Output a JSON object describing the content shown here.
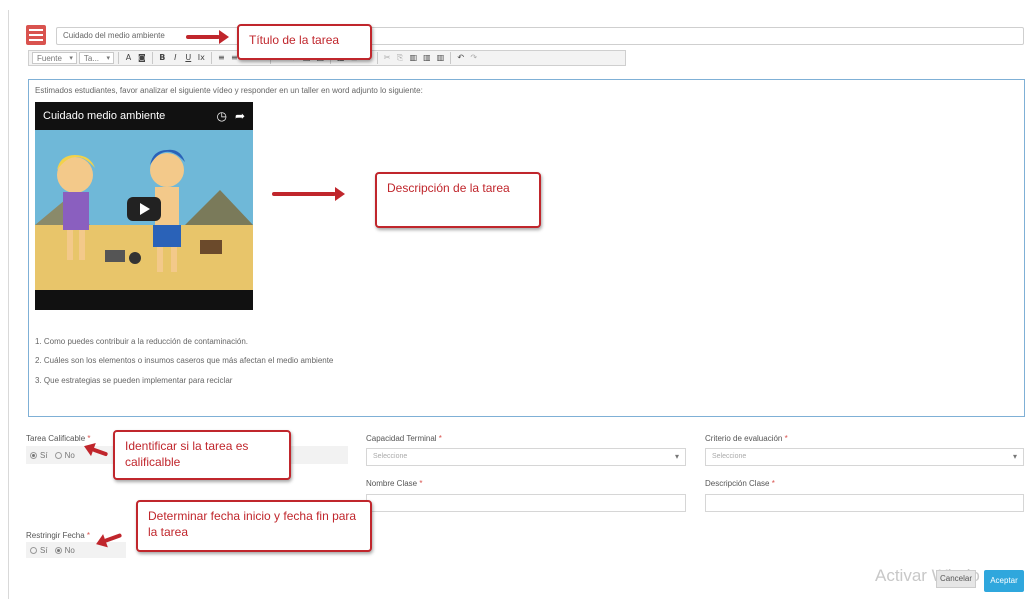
{
  "task": {
    "title_value": "Cuidado del medio ambiente"
  },
  "toolbar": {
    "items": [
      {
        "name": "font-dropdown",
        "label": "Fuente"
      },
      {
        "name": "size-dropdown",
        "label": "Ta..."
      },
      {
        "name": "text-color-button",
        "label": "A"
      },
      {
        "name": "bg-color-button",
        "label": "◙"
      },
      {
        "name": "bold-button",
        "label": "B"
      },
      {
        "name": "italic-button",
        "label": "I"
      },
      {
        "name": "underline-button",
        "label": "U"
      },
      {
        "name": "clear-format-button",
        "label": "Ix"
      },
      {
        "name": "align-left-button",
        "label": "≡"
      },
      {
        "name": "align-center-button",
        "label": "≡"
      },
      {
        "name": "align-right-button",
        "label": "≡"
      },
      {
        "name": "justify-button",
        "label": "≡"
      },
      {
        "name": "link-button",
        "label": "∞"
      },
      {
        "name": "unlink-button",
        "label": "⊘"
      },
      {
        "name": "image-button",
        "label": "▣"
      },
      {
        "name": "media-button",
        "label": "▤"
      },
      {
        "name": "table-button",
        "label": "▦"
      },
      {
        "name": "hr-button",
        "label": "⊟"
      },
      {
        "name": "special-char-button",
        "label": "Ω"
      },
      {
        "name": "cut-button",
        "label": "✂"
      },
      {
        "name": "copy-button",
        "label": "⎘"
      },
      {
        "name": "paste-button",
        "label": "▥"
      },
      {
        "name": "paste-text-button",
        "label": "▥"
      },
      {
        "name": "paste-word-button",
        "label": "▥"
      },
      {
        "name": "undo-button",
        "label": "↶"
      },
      {
        "name": "redo-button",
        "label": "↷"
      }
    ]
  },
  "editor": {
    "intro": "Estimados estudiantes, favor analizar el siguiente vídeo y responder en un taller en word adjunto lo siguiente:",
    "video_title": "Cuidado medio ambiente",
    "questions": [
      "1. Como puedes contribuir a la reducción de contaminación.",
      "2. Cuáles son los elementos o insumos caseros que más afectan el medio ambiente",
      "3. Que estrategias se pueden implementar para reciclar"
    ]
  },
  "form": {
    "calificable_label": "Tarea Calificable",
    "yes": "Sí",
    "no": "No",
    "restringir_label": "Restringir Fecha",
    "capacidad_label": "Capacidad Terminal",
    "capacidad_placeholder": "Seleccione",
    "criterio_label": "Criterio de evaluación",
    "criterio_placeholder": "Seleccione",
    "nombre_clase_label": "Nombre Clase",
    "descripcion_clase_label": "Descripción Clase",
    "required_mark": "*"
  },
  "annotations": {
    "title": "Título de la tarea",
    "description": "Descripción de la tarea",
    "calificable": "Identificar si la tarea es calificalble",
    "fecha": "Determinar fecha inicio y fecha fin para la tarea"
  },
  "footer": {
    "watermark": "Activar Windo",
    "cancel": "Cancelar",
    "accept": "Aceptar"
  },
  "colors": {
    "accent": "#2fa7dd",
    "callout": "#c0262c",
    "icon": "#d9534f"
  }
}
